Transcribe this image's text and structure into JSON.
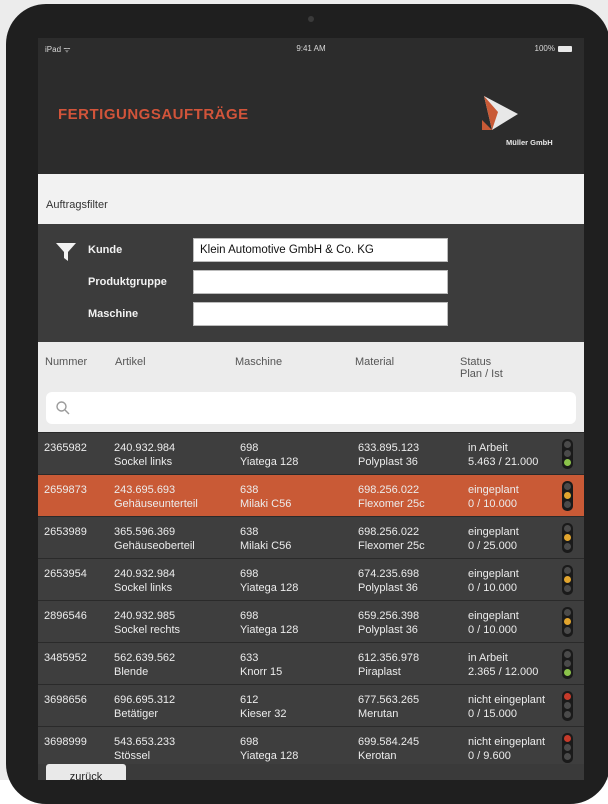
{
  "statusbar": {
    "left": "iPad ᯤ",
    "time": "9:41 AM",
    "battery": "100%"
  },
  "app": {
    "title": "FERTIGUNGSAUFTRÄGE",
    "company": "Müller GmbH"
  },
  "filter": {
    "heading": "Auftragsfilter",
    "kunde_label": "Kunde",
    "kunde_value": "Klein Automotive GmbH & Co. KG",
    "produktgruppe_label": "Produktgruppe",
    "produktgruppe_value": "",
    "maschine_label": "Maschine",
    "maschine_value": ""
  },
  "columns": {
    "nummer": "Nummer",
    "artikel": "Artikel",
    "maschine": "Maschine",
    "material": "Material",
    "status1": "Status",
    "status2": "Plan / Ist"
  },
  "search": {
    "placeholder": ""
  },
  "rows": [
    {
      "nummer": "2365982",
      "artikel1": "240.932.984",
      "artikel2": "Sockel links",
      "maschine1": "698",
      "maschine2": "Yiatega 128",
      "material1": "633.895.123",
      "material2": "Polyplast 36",
      "status1": "in Arbeit",
      "status2": "5.463 / 21.000",
      "light": "green"
    },
    {
      "nummer": "2659873",
      "artikel1": "243.695.693",
      "artikel2": "Gehäuseunterteil",
      "maschine1": "638",
      "maschine2": "Milaki C56",
      "material1": "698.256.022",
      "material2": "Flexomer 25c",
      "status1": "eingeplant",
      "status2": "0 / 10.000",
      "light": "yellow"
    },
    {
      "nummer": "2653989",
      "artikel1": "365.596.369",
      "artikel2": "Gehäuseoberteil",
      "maschine1": "638",
      "maschine2": "Milaki C56",
      "material1": "698.256.022",
      "material2": "Flexomer 25c",
      "status1": "eingeplant",
      "status2": "0 / 25.000",
      "light": "yellow"
    },
    {
      "nummer": "2653954",
      "artikel1": "240.932.984",
      "artikel2": "Sockel links",
      "maschine1": "698",
      "maschine2": "Yiatega 128",
      "material1": "674.235.698",
      "material2": "Polyplast 36",
      "status1": "eingeplant",
      "status2": "0 / 10.000",
      "light": "yellow"
    },
    {
      "nummer": "2896546",
      "artikel1": "240.932.985",
      "artikel2": "Sockel rechts",
      "maschine1": "698",
      "maschine2": "Yiatega 128",
      "material1": "659.256.398",
      "material2": "Polyplast 36",
      "status1": "eingeplant",
      "status2": "0 / 10.000",
      "light": "yellow"
    },
    {
      "nummer": "3485952",
      "artikel1": "562.639.562",
      "artikel2": "Blende",
      "maschine1": "633",
      "maschine2": "Knorr 15",
      "material1": "612.356.978",
      "material2": "Piraplast",
      "status1": "in Arbeit",
      "status2": "2.365 / 12.000",
      "light": "green"
    },
    {
      "nummer": "3698656",
      "artikel1": "696.695.312",
      "artikel2": "Betätiger",
      "maschine1": "612",
      "maschine2": "Kieser 32",
      "material1": "677.563.265",
      "material2": "Merutan",
      "status1": "nicht eingeplant",
      "status2": "0 / 15.000",
      "light": "red"
    },
    {
      "nummer": "3698999",
      "artikel1": "543.653.233",
      "artikel2": "Stössel",
      "maschine1": "698",
      "maschine2": "Yiatega 128",
      "material1": "699.584.245",
      "material2": "Kerotan",
      "status1": "nicht eingeplant",
      "status2": "0 / 9.600",
      "light": "red"
    }
  ],
  "footer": {
    "back_label": "zurück"
  },
  "colors": {
    "accent": "#c95a36",
    "title": "#d2543a",
    "dark": "#2c2c2c"
  },
  "icons": {
    "filter": "filter-funnel-icon",
    "search": "search-icon",
    "logo": "company-logo-icon"
  }
}
